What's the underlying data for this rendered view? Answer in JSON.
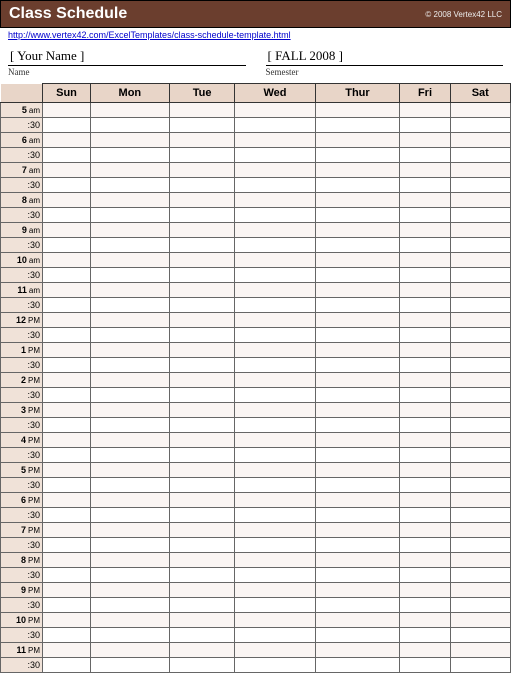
{
  "header": {
    "title": "Class Schedule",
    "copyright": "© 2008 Vertex42 LLC",
    "url": "http://www.vertex42.com/ExcelTemplates/class-schedule-template.html"
  },
  "meta": {
    "name_value": "[ Your Name ]",
    "name_label": "Name",
    "semester_value": "[ FALL 2008 ]",
    "semester_label": "Semester"
  },
  "days": [
    "Sun",
    "Mon",
    "Tue",
    "Wed",
    "Thur",
    "Fri",
    "Sat"
  ],
  "hours": [
    {
      "h": "5",
      "p": "am"
    },
    {
      "h": "6",
      "p": "am"
    },
    {
      "h": "7",
      "p": "am"
    },
    {
      "h": "8",
      "p": "am"
    },
    {
      "h": "9",
      "p": "am"
    },
    {
      "h": "10",
      "p": "am"
    },
    {
      "h": "11",
      "p": "am"
    },
    {
      "h": "12",
      "p": "PM"
    },
    {
      "h": "1",
      "p": "PM"
    },
    {
      "h": "2",
      "p": "PM"
    },
    {
      "h": "3",
      "p": "PM"
    },
    {
      "h": "4",
      "p": "PM"
    },
    {
      "h": "5",
      "p": "PM"
    },
    {
      "h": "6",
      "p": "PM"
    },
    {
      "h": "7",
      "p": "PM"
    },
    {
      "h": "8",
      "p": "PM"
    },
    {
      "h": "9",
      "p": "PM"
    },
    {
      "h": "10",
      "p": "PM"
    },
    {
      "h": "11",
      "p": "PM"
    }
  ],
  "half_label": ":30"
}
